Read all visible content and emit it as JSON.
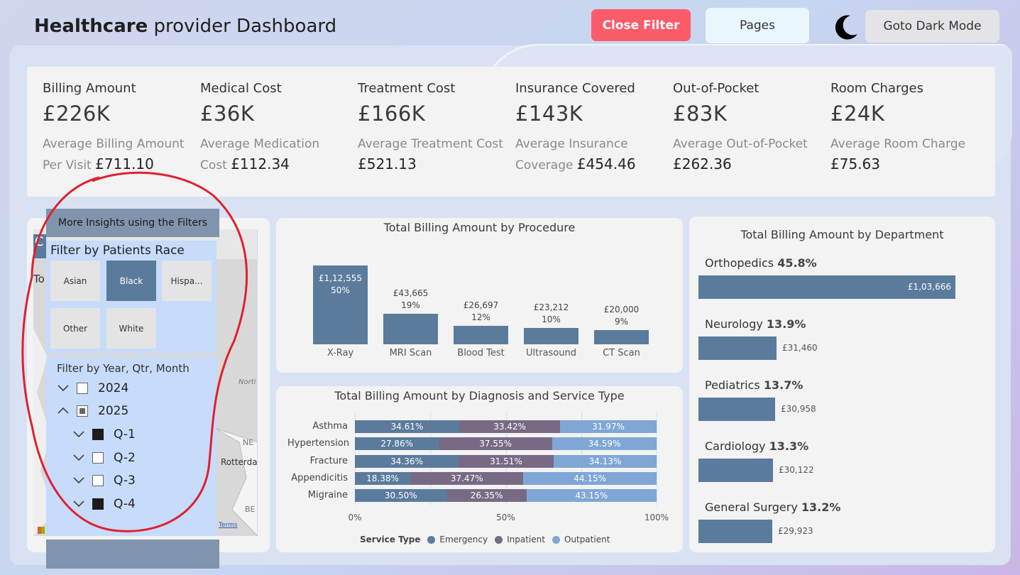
{
  "header": {
    "title_bold": "Healthcare",
    "title_rest": " provider Dashboard",
    "close_filter": "Close Filter",
    "pages": "Pages",
    "dark_mode": "Goto Dark Mode"
  },
  "kpis": [
    {
      "title": "Billing Amount",
      "value": "£226K",
      "sub_a": "Average Billing Amount",
      "sub_b": "Per Visit",
      "sub_value": "£711.10"
    },
    {
      "title": "Medical Cost",
      "value": "£36K",
      "sub_a": "Average Medication",
      "sub_b": "Cost",
      "sub_value": "£112.34"
    },
    {
      "title": "Treatment Cost",
      "value": "£166K",
      "sub_a": "Average Treatment Cost",
      "sub_b": "",
      "sub_value": "£521.13"
    },
    {
      "title": "Insurance Covered",
      "value": "£143K",
      "sub_a": "Average Insurance",
      "sub_b": "Coverage",
      "sub_value": "£454.46"
    },
    {
      "title": "Out-of-Pocket",
      "value": "£83K",
      "sub_a": "Average Out-of-Pocket",
      "sub_b": "",
      "sub_value": "£262.36"
    },
    {
      "title": "Room Charges",
      "value": "£24K",
      "sub_a": "Average Room Charge",
      "sub_b": "",
      "sub_value": "£75.63"
    }
  ],
  "map": {
    "label_c": "C",
    "label_to": "To",
    "label_north": "Norti",
    "label_ne": "NE",
    "label_rotterdam": "Rotterda",
    "label_be": "BE",
    "terms": "Terms"
  },
  "filters": {
    "header_a": "More Insights",
    "header_b": " using the ",
    "header_c": "Filters",
    "race_title": "Filter by Patients Race",
    "race_options": [
      {
        "label": "Asian",
        "selected": false
      },
      {
        "label": "Black",
        "selected": true
      },
      {
        "label": "Hispa...",
        "selected": false
      },
      {
        "label": "Other",
        "selected": false
      },
      {
        "label": "White",
        "selected": false
      }
    ],
    "date_title": "Filter by Year, Qtr, Month",
    "tree": [
      {
        "label": "2024",
        "state": "empty",
        "expanded": false
      },
      {
        "label": "2025",
        "state": "partial",
        "expanded": true
      },
      {
        "label": "Q-1",
        "state": "full",
        "expanded": false
      },
      {
        "label": "Q-2",
        "state": "empty",
        "expanded": false
      },
      {
        "label": "Q-3",
        "state": "empty",
        "expanded": false
      },
      {
        "label": "Q-4",
        "state": "full",
        "expanded": false
      }
    ]
  },
  "chart_data": [
    {
      "type": "bar",
      "title": "Total Billing Amount by Procedure",
      "categories": [
        "X-Ray",
        "MRI Scan",
        "Blood Test",
        "Ultrasound",
        "CT Scan"
      ],
      "values": [
        112555,
        43665,
        26697,
        23212,
        20000
      ],
      "value_labels": [
        "£1,12,555",
        "£43,665",
        "£26,697",
        "£23,212",
        "£20,000"
      ],
      "pct_labels": [
        "50%",
        "19%",
        "12%",
        "10%",
        "9%"
      ],
      "color": "#5b7b9c"
    },
    {
      "type": "bar",
      "orientation": "horizontal-stacked-100",
      "title": "Total Billing Amount by Diagnosis and Service Type",
      "categories": [
        "Asthma",
        "Hypertension",
        "Fracture",
        "Appendicitis",
        "Migraine"
      ],
      "series": [
        {
          "name": "Emergency",
          "values": [
            34.61,
            27.86,
            34.36,
            18.38,
            30.5
          ],
          "labels": [
            "34.61%",
            "27.86%",
            "34.36%",
            "18.38%",
            "30.50%"
          ],
          "color": "#5b7b9c"
        },
        {
          "name": "Inpatient",
          "values": [
            33.42,
            37.55,
            31.51,
            37.47,
            26.35
          ],
          "labels": [
            "33.42%",
            "37.55%",
            "31.51%",
            "37.47%",
            "26.35%"
          ],
          "color": "#786a85"
        },
        {
          "name": "Outpatient",
          "values": [
            31.97,
            34.59,
            34.13,
            44.15,
            43.15
          ],
          "labels": [
            "31.97%",
            "34.59%",
            "34.13%",
            "44.15%",
            "43.15%"
          ],
          "color": "#7fa7d6"
        }
      ],
      "xticks": [
        "0%",
        "50%",
        "100%"
      ],
      "legend_title": "Service Type",
      "legend_position": "bottom"
    },
    {
      "type": "bar",
      "orientation": "horizontal",
      "title": "Total Billing Amount by Department",
      "categories": [
        "Orthopedics",
        "Neurology",
        "Pediatrics",
        "Cardiology",
        "General Surgery"
      ],
      "pct_labels": [
        "45.8%",
        "13.9%",
        "13.7%",
        "13.3%",
        "13.2%"
      ],
      "values": [
        103666,
        31460,
        30958,
        30122,
        29923
      ],
      "value_labels": [
        "£1,03,666",
        "£31,460",
        "£30,958",
        "£30,122",
        "£29,923"
      ],
      "color": "#5b7b9c"
    }
  ],
  "annotation": {
    "color": "#e0202f"
  }
}
